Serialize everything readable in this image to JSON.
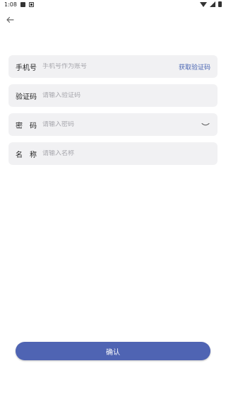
{
  "status_bar": {
    "time": "1:08",
    "icons": [
      "image-icon",
      "notification-icon",
      "wifi-icon",
      "signal-icon",
      "battery-icon"
    ]
  },
  "header": {
    "back_icon": "back-arrow-icon"
  },
  "form": {
    "phone": {
      "label": "手机号",
      "placeholder": "手机号作为账号",
      "value": "",
      "get_code_label": "获取验证码"
    },
    "code": {
      "label": "验证码",
      "placeholder": "请输入验证码",
      "value": ""
    },
    "password": {
      "label": "密　码",
      "placeholder": "请输入密码",
      "value": "",
      "toggle_icon": "eye-closed-icon"
    },
    "name": {
      "label": "名　称",
      "placeholder": "请输入名称",
      "value": ""
    }
  },
  "confirm_label": "确认",
  "colors": {
    "accent": "#4f64b3",
    "link": "#4a66b3",
    "field_bg": "#f1f1f3",
    "placeholder": "#a7a7ad"
  }
}
